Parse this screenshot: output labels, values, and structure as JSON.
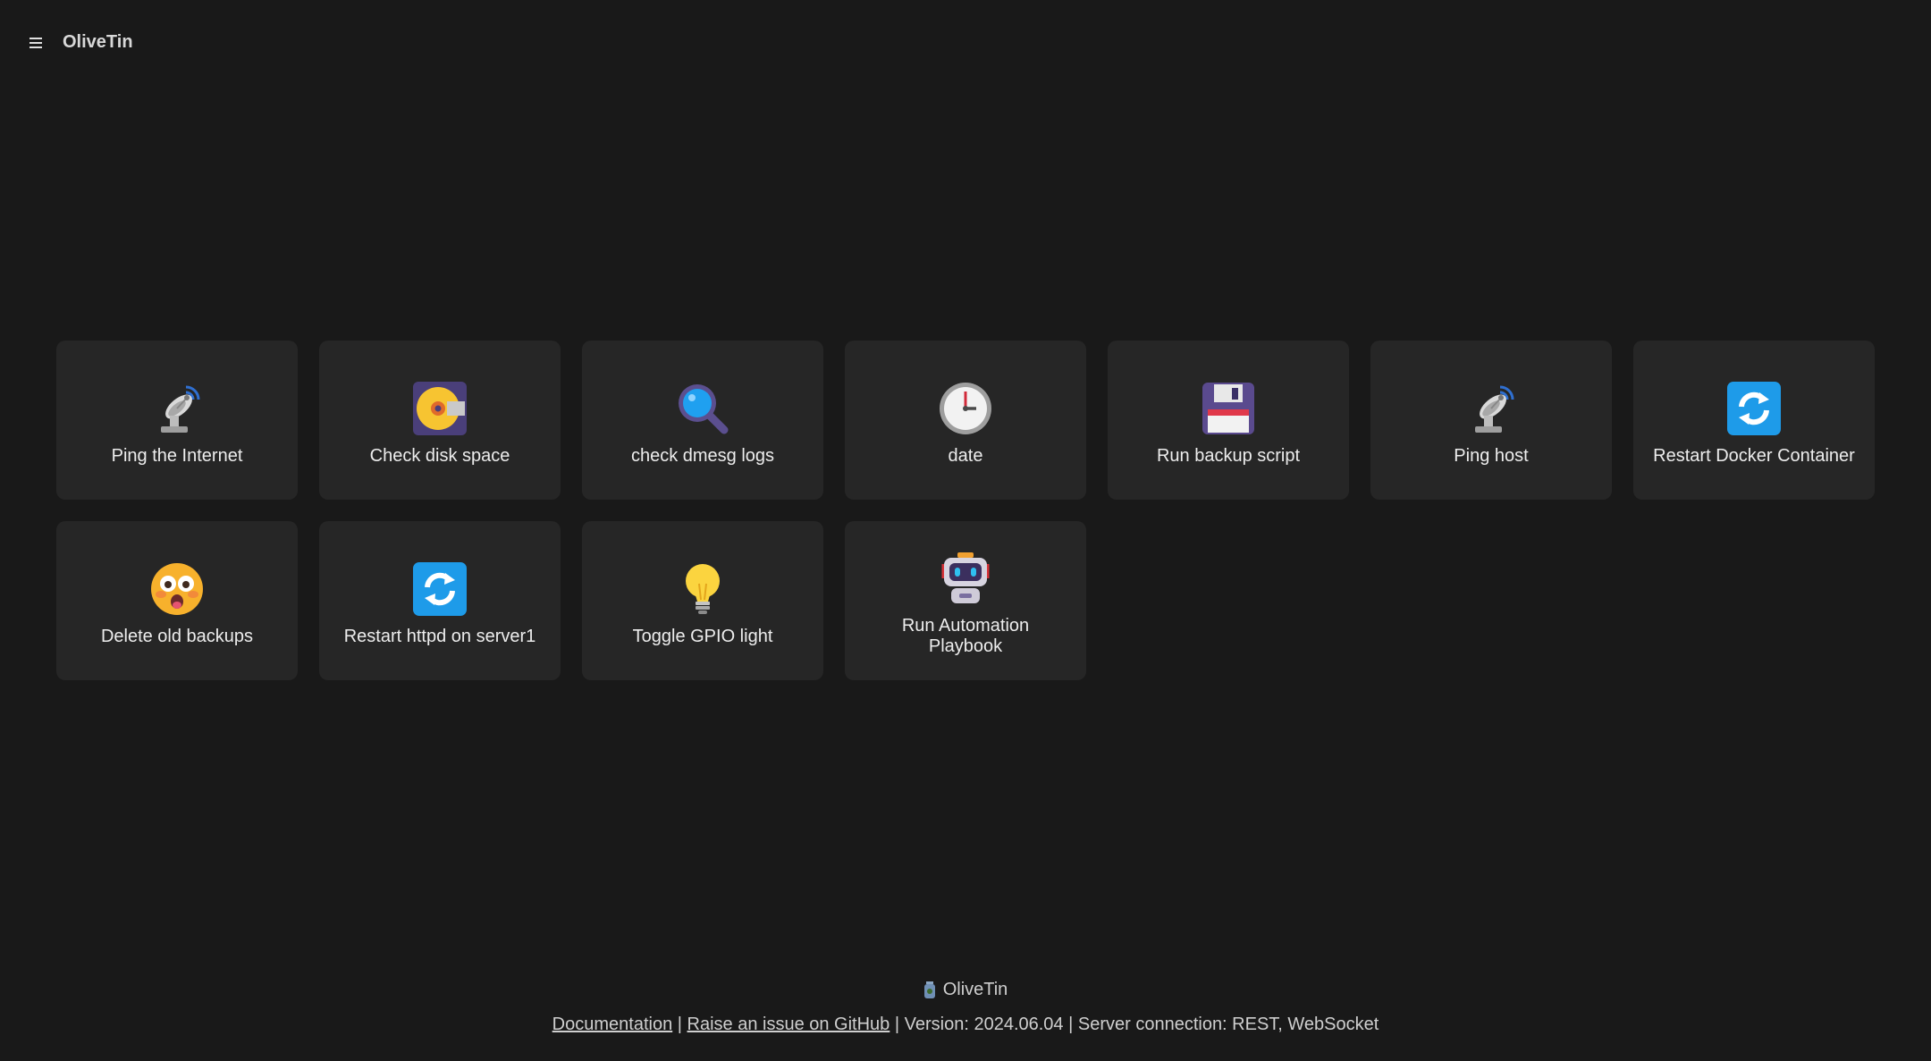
{
  "header": {
    "menu_icon": "hamburger-icon",
    "title": "OliveTin"
  },
  "actions": [
    {
      "label": "Ping the Internet",
      "icon": "satellite-dish-icon"
    },
    {
      "label": "Check disk space",
      "icon": "optical-disk-icon"
    },
    {
      "label": "check dmesg logs",
      "icon": "magnifying-glass-icon"
    },
    {
      "label": "date",
      "icon": "clock-icon"
    },
    {
      "label": "Run backup script",
      "icon": "floppy-disk-icon"
    },
    {
      "label": "Ping host",
      "icon": "satellite-dish-icon"
    },
    {
      "label": "Restart Docker Container",
      "icon": "refresh-icon"
    },
    {
      "label": "Delete old backups",
      "icon": "flushed-face-icon"
    },
    {
      "label": "Restart httpd on server1",
      "icon": "refresh-icon"
    },
    {
      "label": "Toggle GPIO light",
      "icon": "light-bulb-icon"
    },
    {
      "label": "Run Automation Playbook",
      "icon": "robot-icon"
    }
  ],
  "footer": {
    "brand": "OliveTin",
    "brand_icon": "olive-jar-icon",
    "documentation_link": "Documentation",
    "github_link": "Raise an issue on GitHub",
    "sep1": " | ",
    "sep2": " | ",
    "version_text": "Version: 2024.06.04",
    "sep3": " | ",
    "server_connection_text": "Server connection: REST, WebSocket"
  },
  "colors": {
    "background": "#191919",
    "card": "#262626",
    "text": "#ededed",
    "refresh_blue": "#1e9be9"
  }
}
